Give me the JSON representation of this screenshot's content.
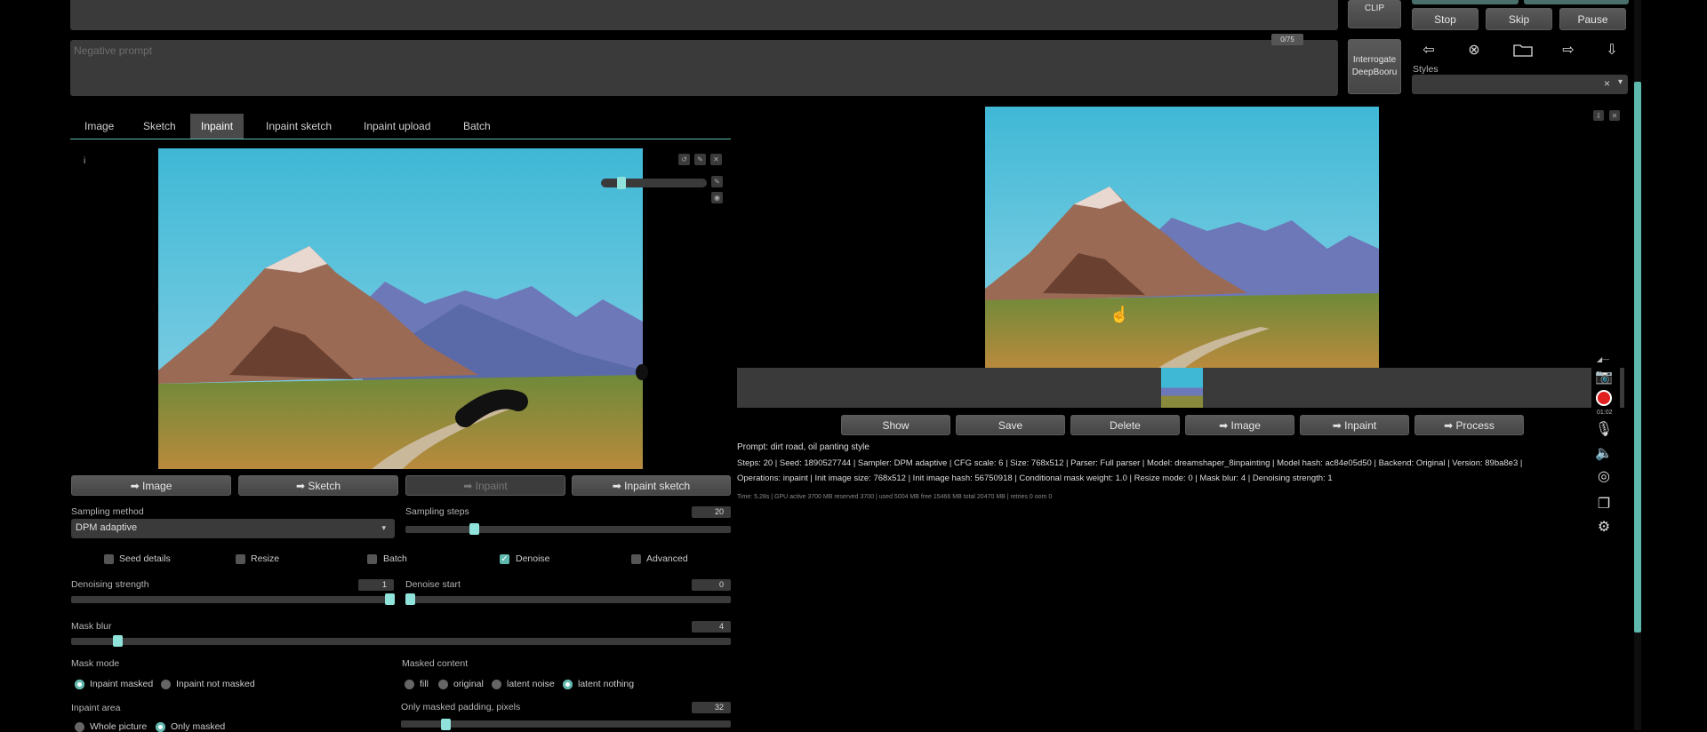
{
  "negative_prompt": {
    "placeholder": "Negative prompt",
    "token_count": "0/75"
  },
  "interrogate": {
    "clip_label": "CLIP",
    "deepbooru_label": "Interrogate DeepBooru"
  },
  "controls": {
    "stop": "Stop",
    "skip": "Skip",
    "pause": "Pause"
  },
  "styles": {
    "label": "Styles",
    "clear": "×",
    "dropdown": "▾"
  },
  "tool_icons": {
    "back": "⇦",
    "clear": "⊗",
    "folder": "folder-icon",
    "send": "⇨",
    "download": "⇩"
  },
  "tabs": [
    {
      "label": "Image"
    },
    {
      "label": "Sketch"
    },
    {
      "label": "Inpaint"
    },
    {
      "label": "Inpaint sketch"
    },
    {
      "label": "Inpaint upload"
    },
    {
      "label": "Batch"
    }
  ],
  "canvas": {
    "info_mark": "i",
    "brush_size_fraction": 0.15
  },
  "send_buttons": [
    "➡ Image",
    "➡ Sketch",
    "➡ Inpaint",
    "➡ Inpaint sketch"
  ],
  "sampling_method": {
    "label": "Sampling method",
    "value": "DPM adaptive"
  },
  "sampling_steps": {
    "label": "Sampling steps",
    "value": "20"
  },
  "checkboxes": [
    {
      "label": "Seed details",
      "checked": false
    },
    {
      "label": "Resize",
      "checked": false
    },
    {
      "label": "Batch",
      "checked": false
    },
    {
      "label": "Denoise",
      "checked": true
    },
    {
      "label": "Advanced",
      "checked": false
    }
  ],
  "denoising_strength": {
    "label": "Denoising strength",
    "value": "1"
  },
  "denoise_start": {
    "label": "Denoise start",
    "value": "0"
  },
  "mask_blur": {
    "label": "Mask blur",
    "value": "4"
  },
  "mask_mode": {
    "label": "Mask mode",
    "options": [
      "Inpaint masked",
      "Inpaint not masked"
    ],
    "selected": 0
  },
  "masked_content": {
    "label": "Masked content",
    "options": [
      "fill",
      "original",
      "latent noise",
      "latent nothing"
    ],
    "selected": 3
  },
  "inpaint_area": {
    "label": "Inpaint area",
    "options": [
      "Whole picture",
      "Only masked"
    ],
    "selected": 1
  },
  "padding": {
    "label": "Only masked padding, pixels",
    "value": "32"
  },
  "output_buttons": [
    "Show",
    "Save",
    "Delete",
    "➡ Image",
    "➡ Inpaint",
    "➡ Process"
  ],
  "info": {
    "prompt": "Prompt: dirt road, oil panting style",
    "steps": "Steps: 20 | Seed: 1890527744 | Sampler: DPM adaptive | CFG scale: 6 | Size: 768x512 | Parser: Full parser | Model: dreamshaper_8inpainting | Model hash: ac84e05d50 | Backend: Original | Version: 89ba8e3 |",
    "operations": "Operations: inpaint | Init image size: 768x512 | Init image hash: 56750918 | Conditional mask weight: 1.0 | Resize mode: 0 | Mask blur: 4 | Denoising strength: 1",
    "timing": "Time: 5.28s | GPU active 3700 MB reserved 3700 | used 5004 MB free 15466 MB total 20470 MB | retries 0 oom 0"
  },
  "side_toolbar": {
    "time": "01:02"
  }
}
